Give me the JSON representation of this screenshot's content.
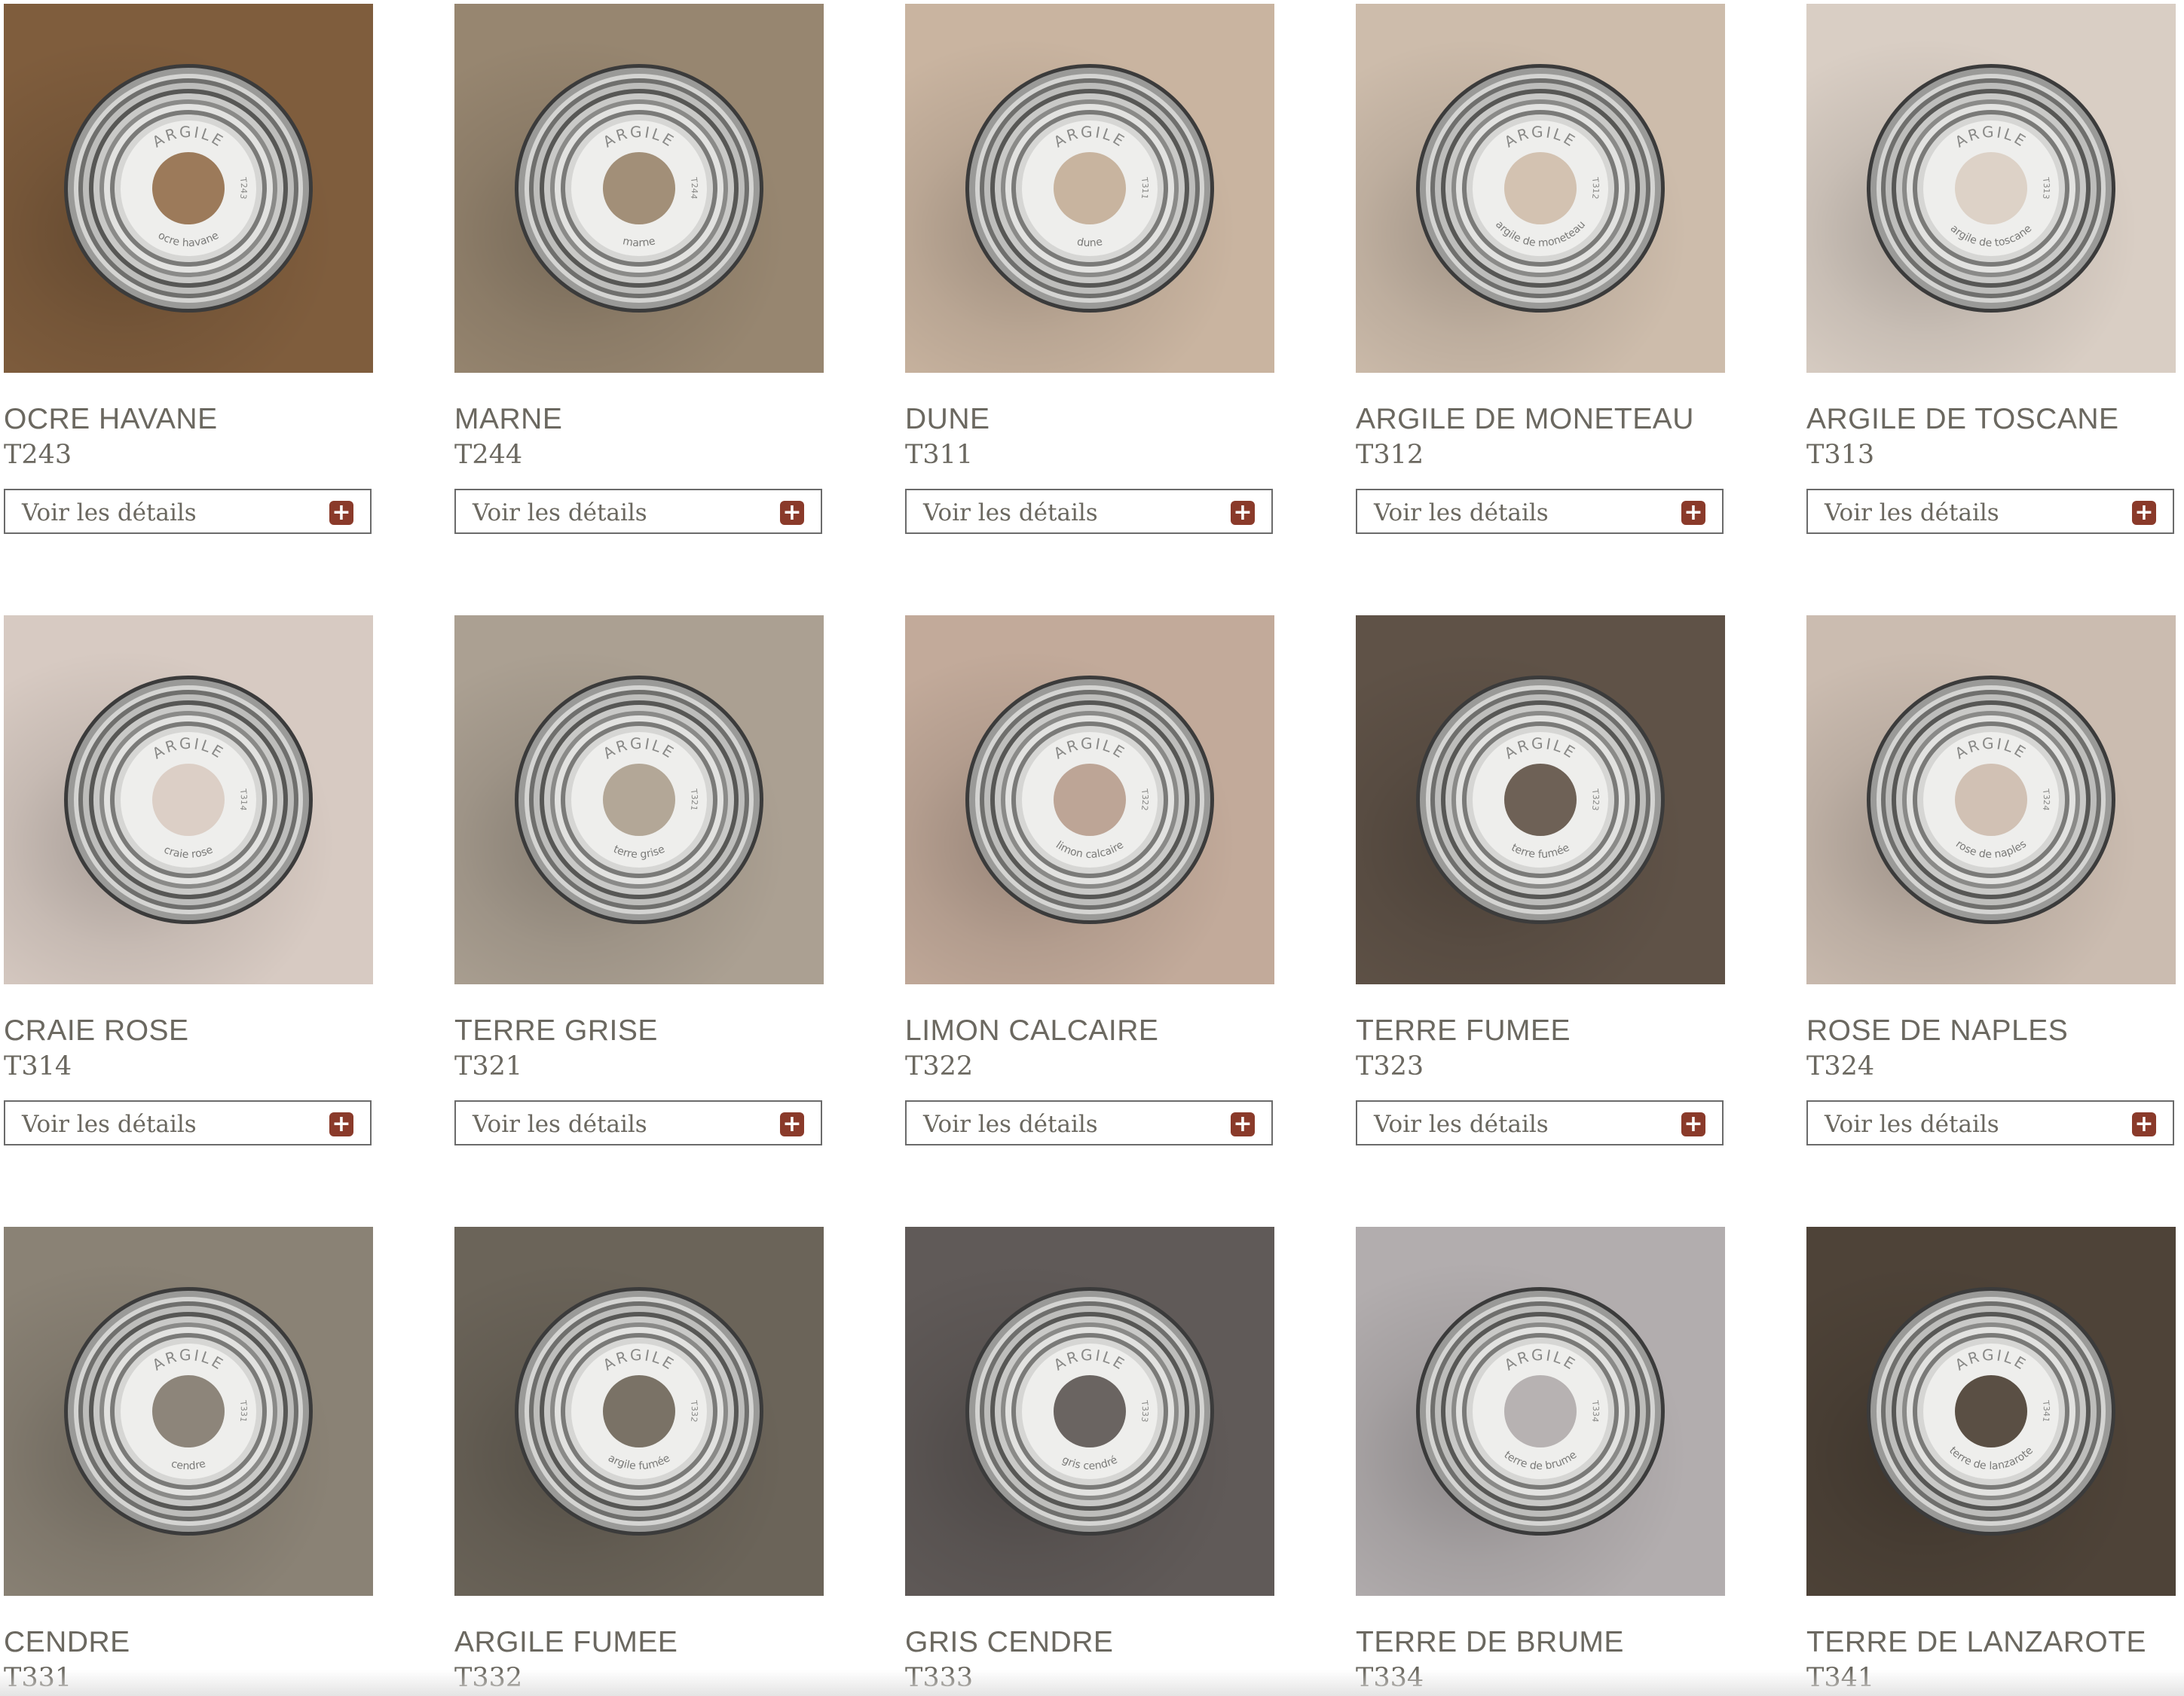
{
  "products": [
    {
      "name": "OCRE HAVANE",
      "code": "T243",
      "label": "ocre havane",
      "code_label": "T243",
      "color": "#7f5d3d",
      "center_color": "#9c7a5a"
    },
    {
      "name": "MARNE",
      "code": "T244",
      "label": "marne",
      "code_label": "T244",
      "color": "#978670",
      "center_color": "#a28f78"
    },
    {
      "name": "DUNE",
      "code": "T311",
      "label": "dune",
      "code_label": "T311",
      "color": "#c9b4a0",
      "center_color": "#c8b49f"
    },
    {
      "name": "ARGILE DE MONETEAU",
      "code": "T312",
      "label": "argile de moneteau",
      "code_label": "T312",
      "color": "#cdbcab",
      "center_color": "#d3c2b1"
    },
    {
      "name": "ARGILE DE TOSCANE",
      "code": "T313",
      "label": "argile de toscane",
      "code_label": "T313",
      "color": "#d9cec4",
      "center_color": "#ddd2c7"
    },
    {
      "name": "CRAIE ROSE",
      "code": "T314",
      "label": "craie rose",
      "code_label": "T314",
      "color": "#d7cac2",
      "center_color": "#dccfc6"
    },
    {
      "name": "TERRE GRISE",
      "code": "T321",
      "label": "terre grise",
      "code_label": "T321",
      "color": "#aba092",
      "center_color": "#b3a797"
    },
    {
      "name": "LIMON CALCAIRE",
      "code": "T322",
      "label": "limon calcaire",
      "code_label": "T322",
      "color": "#c2aa9a",
      "center_color": "#bda596"
    },
    {
      "name": "TERRE FUMEE",
      "code": "T323",
      "label": "terre fumée",
      "code_label": "T323",
      "color": "#5f5247",
      "center_color": "#6e6156"
    },
    {
      "name": "ROSE DE NAPLES",
      "code": "T324",
      "label": "rose de naples",
      "code_label": "T324",
      "color": "#cbbcb0",
      "center_color": "#d1c1b4"
    },
    {
      "name": "CENDRE",
      "code": "T331",
      "label": "cendre",
      "code_label": "T331",
      "color": "#8a8275",
      "center_color": "#8d857a"
    },
    {
      "name": "ARGILE FUMEE",
      "code": "T332",
      "label": "argile fumée",
      "code_label": "T332",
      "color": "#6b6459",
      "center_color": "#7a7266"
    },
    {
      "name": "GRIS CENDRE",
      "code": "T333",
      "label": "gris cendré",
      "code_label": "T333",
      "color": "#605a58",
      "center_color": "#6a6461"
    },
    {
      "name": "TERRE DE BRUME",
      "code": "T334",
      "label": "terre de brume",
      "code_label": "T334",
      "color": "#b2adae",
      "center_color": "#b7b2b2"
    },
    {
      "name": "TERRE DE LANZAROTE",
      "code": "T341",
      "label": "terre de lanzarote",
      "code_label": "T341",
      "color": "#4e4338",
      "center_color": "#5a4f44"
    }
  ],
  "can_brand": "ARGILE",
  "button_label": "Voir les détails",
  "button_icon": "plus-icon",
  "accent_color": "#8a3a2a"
}
